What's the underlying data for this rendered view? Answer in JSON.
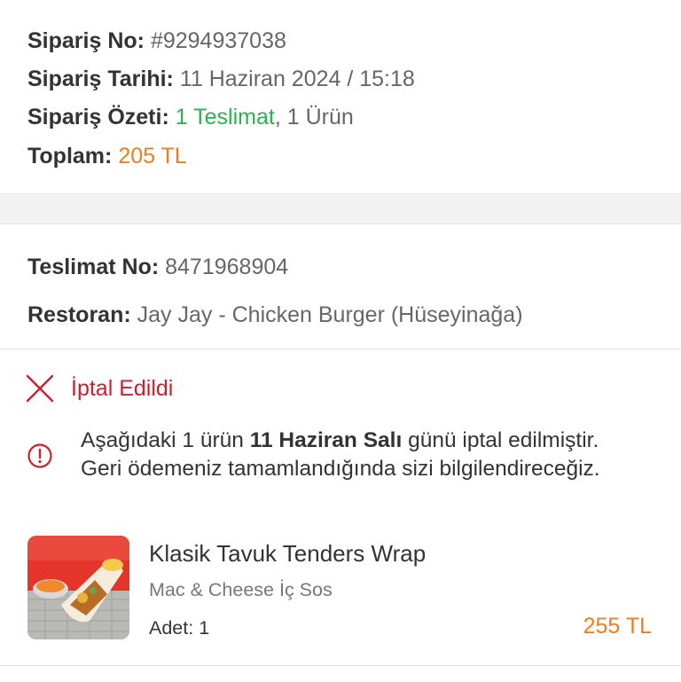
{
  "order": {
    "number_label": "Sipariş No:",
    "number_value": "#9294937038",
    "date_label": "Sipariş Tarihi:",
    "date_value": "11 Haziran 2024 / 15:18",
    "summary_label": "Sipariş Özeti:",
    "summary_deliveries": "1 Teslimat",
    "summary_separator": ",",
    "summary_items": "1 Ürün",
    "total_label": "Toplam:",
    "total_value": "205 TL"
  },
  "delivery": {
    "number_label": "Teslimat No:",
    "number_value": "8471968904",
    "restaurant_label": "Restoran:",
    "restaurant_value": "Jay Jay - Chicken Burger (Hüseyinağa)",
    "status_icon": "close-x-icon",
    "status_text": "İptal Edildi",
    "info_icon": "info-circle-icon",
    "info_line1_pre": "Aşağıdaki 1 ürün",
    "info_line1_bold": "11 Haziran Salı",
    "info_line1_post": "günü iptal edilmiştir.",
    "info_line2": "Geri ödemeniz tamamlandığında sizi bilgilendireceğiz."
  },
  "product": {
    "name": "Klasik Tavuk Tenders Wrap",
    "option": "Mac & Cheese İç Sos",
    "qty_label": "Adet:",
    "qty_value": "1",
    "price": "255 TL"
  },
  "colors": {
    "accent_green": "#2bb24c",
    "accent_orange": "#f07d1a",
    "cancel_red": "#cc1f2c"
  }
}
